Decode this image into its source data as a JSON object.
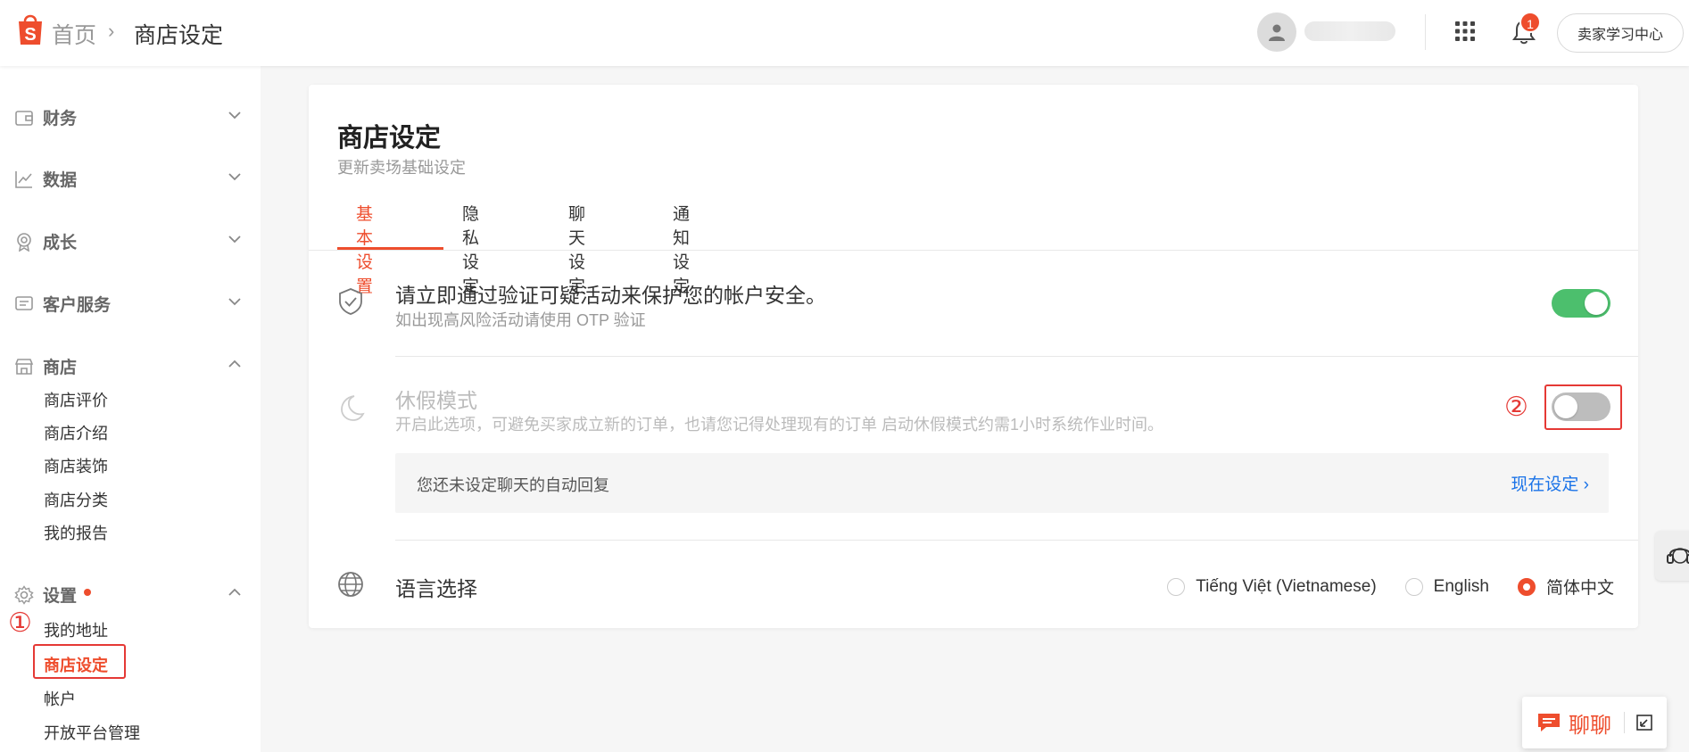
{
  "header": {
    "logo_letter": "S",
    "breadcrumb_home": "首页",
    "breadcrumb_separator": "›",
    "breadcrumb_current": "商店设定",
    "notification_count": "1",
    "learning_center_label": "卖家学习中心"
  },
  "sidebar": {
    "groups": [
      {
        "label": "财务",
        "icon": "wallet-icon",
        "expanded": false
      },
      {
        "label": "数据",
        "icon": "chart-icon",
        "expanded": false
      },
      {
        "label": "成长",
        "icon": "award-icon",
        "expanded": false
      },
      {
        "label": "客户服务",
        "icon": "message-icon",
        "expanded": false
      },
      {
        "label": "商店",
        "icon": "store-icon",
        "expanded": true
      },
      {
        "label": "设置",
        "icon": "gear-icon",
        "expanded": true
      }
    ],
    "shop_items": [
      "商店评价",
      "商店介绍",
      "商店装饰",
      "商店分类",
      "我的报告"
    ],
    "settings_items": [
      "我的地址",
      "商店设定",
      "帐户",
      "开放平台管理"
    ],
    "annotation_1": "①"
  },
  "main": {
    "title": "商店设定",
    "subtitle": "更新卖场基础设定",
    "tabs": [
      "基本设置",
      "隐私设定",
      "聊天设定",
      "通知设定"
    ],
    "active_tab": "基本设置",
    "security": {
      "title": "请立即通过验证可疑活动来保护您的帐户安全。",
      "desc": "如出现高风险活动请使用 OTP 验证",
      "enabled": true
    },
    "vacation": {
      "title": "休假模式",
      "desc": "开启此选项，可避免买家成立新的订单，也请您记得处理现有的订单 启动休假模式约需1小时系统作业时间。",
      "enabled": false,
      "annotation": "②"
    },
    "auto_reply": {
      "text": "您还未设定聊天的自动回复",
      "link": "现在设定 ›"
    },
    "language": {
      "title": "语言选择",
      "options": [
        "Tiếng Việt (Vietnamese)",
        "English",
        "简体中文"
      ],
      "selected": "简体中文"
    }
  },
  "floating": {
    "chat_label": "聊聊"
  },
  "colors": {
    "brand": "#ee4d2d",
    "toggle_on": "#4cbf6d",
    "link": "#1a73e8",
    "annotation": "#e53935"
  }
}
